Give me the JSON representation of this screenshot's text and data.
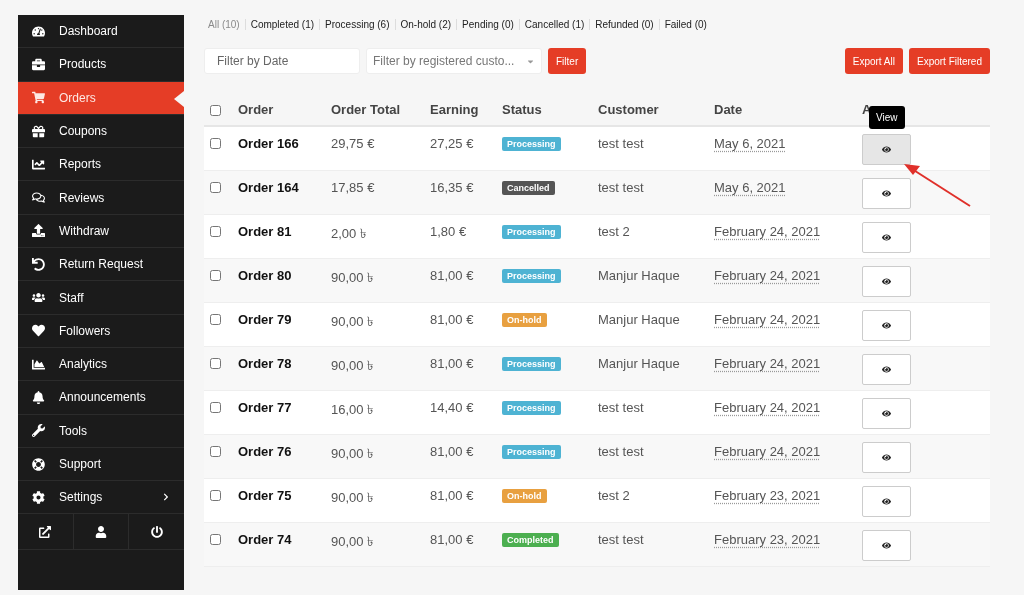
{
  "sidebar": {
    "items": [
      {
        "label": "Dashboard",
        "selected": false,
        "submenu": false
      },
      {
        "label": "Products",
        "selected": false,
        "submenu": false
      },
      {
        "label": "Orders",
        "selected": true,
        "submenu": false
      },
      {
        "label": "Coupons",
        "selected": false,
        "submenu": false
      },
      {
        "label": "Reports",
        "selected": false,
        "submenu": false
      },
      {
        "label": "Reviews",
        "selected": false,
        "submenu": false
      },
      {
        "label": "Withdraw",
        "selected": false,
        "submenu": false
      },
      {
        "label": "Return Request",
        "selected": false,
        "submenu": false
      },
      {
        "label": "Staff",
        "selected": false,
        "submenu": false
      },
      {
        "label": "Followers",
        "selected": false,
        "submenu": false
      },
      {
        "label": "Analytics",
        "selected": false,
        "submenu": false
      },
      {
        "label": "Announcements",
        "selected": false,
        "submenu": false
      },
      {
        "label": "Tools",
        "selected": false,
        "submenu": false
      },
      {
        "label": "Support",
        "selected": false,
        "submenu": false
      },
      {
        "label": "Settings",
        "selected": false,
        "submenu": true
      }
    ]
  },
  "status_tabs": [
    {
      "label": "All (10)",
      "selected": true
    },
    {
      "label": "Completed (1)",
      "selected": false
    },
    {
      "label": "Processing (6)",
      "selected": false
    },
    {
      "label": "On-hold (2)",
      "selected": false
    },
    {
      "label": "Pending (0)",
      "selected": false
    },
    {
      "label": "Cancelled (1)",
      "selected": false
    },
    {
      "label": "Refunded (0)",
      "selected": false
    },
    {
      "label": "Failed (0)",
      "selected": false
    }
  ],
  "filters": {
    "date": {
      "placeholder": "Filter by Date"
    },
    "customer": {
      "placeholder": "Filter by registered custo..."
    },
    "filter_button": "Filter"
  },
  "export_buttons": [
    "Export All",
    "Export Filtered"
  ],
  "table": {
    "select_all_checked": false,
    "columns": [
      "Order",
      "Order Total",
      "Earning",
      "Status",
      "Customer",
      "Date",
      "A"
    ],
    "tooltip": "View",
    "rows": [
      {
        "checked": false,
        "order": "Order 166",
        "total": "29,75 €",
        "earning": "27,25 €",
        "status": {
          "label": "Processing",
          "kind": "processing"
        },
        "customer": "test test",
        "date": "May 6, 2021",
        "hovered": true
      },
      {
        "checked": false,
        "order": "Order 164",
        "total": "17,85 €",
        "earning": "16,35 €",
        "status": {
          "label": "Cancelled",
          "kind": "cancelled"
        },
        "customer": "test test",
        "date": "May 6, 2021",
        "hovered": false
      },
      {
        "checked": false,
        "order": "Order 81",
        "total": "2,00 ৳",
        "earning": "1,80 €",
        "status": {
          "label": "Processing",
          "kind": "processing"
        },
        "customer": "test 2",
        "date": "February 24, 2021",
        "hovered": false
      },
      {
        "checked": false,
        "order": "Order 80",
        "total": "90,00 ৳",
        "earning": "81,00 €",
        "status": {
          "label": "Processing",
          "kind": "processing"
        },
        "customer": "Manjur Haque",
        "date": "February 24, 2021",
        "hovered": false
      },
      {
        "checked": false,
        "order": "Order 79",
        "total": "90,00 ৳",
        "earning": "81,00 €",
        "status": {
          "label": "On-hold",
          "kind": "on-hold"
        },
        "customer": "Manjur Haque",
        "date": "February 24, 2021",
        "hovered": false
      },
      {
        "checked": false,
        "order": "Order 78",
        "total": "90,00 ৳",
        "earning": "81,00 €",
        "status": {
          "label": "Processing",
          "kind": "processing"
        },
        "customer": "Manjur Haque",
        "date": "February 24, 2021",
        "hovered": false
      },
      {
        "checked": false,
        "order": "Order 77",
        "total": "16,00 ৳",
        "earning": "14,40 €",
        "status": {
          "label": "Processing",
          "kind": "processing"
        },
        "customer": "test test",
        "date": "February 24, 2021",
        "hovered": false
      },
      {
        "checked": false,
        "order": "Order 76",
        "total": "90,00 ৳",
        "earning": "81,00 €",
        "status": {
          "label": "Processing",
          "kind": "processing"
        },
        "customer": "test test",
        "date": "February 24, 2021",
        "hovered": false
      },
      {
        "checked": false,
        "order": "Order 75",
        "total": "90,00 ৳",
        "earning": "81,00 €",
        "status": {
          "label": "On-hold",
          "kind": "on-hold"
        },
        "customer": "test 2",
        "date": "February 23, 2021",
        "hovered": false
      },
      {
        "checked": false,
        "order": "Order 74",
        "total": "90,00 ৳",
        "earning": "81,00 €",
        "status": {
          "label": "Completed",
          "kind": "completed"
        },
        "customer": "test test",
        "date": "February 23, 2021",
        "hovered": false
      }
    ]
  }
}
